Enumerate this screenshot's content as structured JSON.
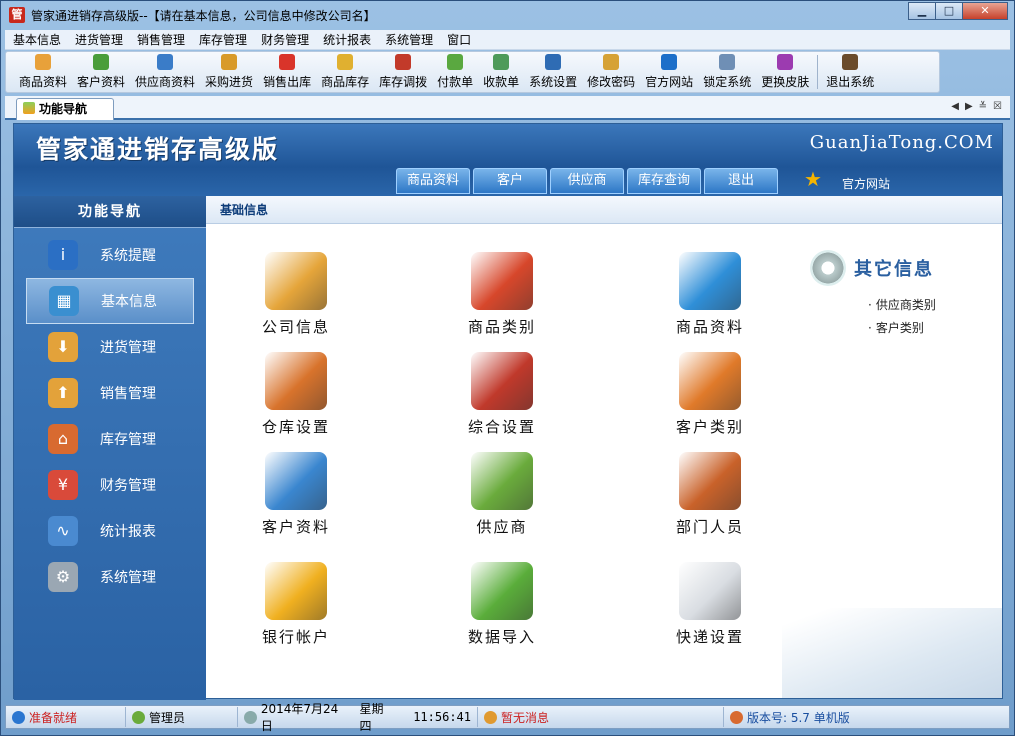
{
  "window": {
    "title": "管家通进销存高级版--【请在基本信息，公司信息中修改公司名】",
    "app_icon": "管",
    "min": "▁",
    "max": "□",
    "close": "✕"
  },
  "menu": [
    "基本信息",
    "进货管理",
    "销售管理",
    "库存管理",
    "财务管理",
    "统计报表",
    "系统管理",
    "窗口"
  ],
  "toolbar": [
    {
      "label": "商品资料",
      "icon": "goods-icon",
      "color": "#e8a13a"
    },
    {
      "label": "客户资料",
      "icon": "customer-icon",
      "color": "#4a9d3a"
    },
    {
      "label": "供应商资料",
      "icon": "supplier-icon",
      "color": "#3a7cc8"
    },
    {
      "label": "采购进货",
      "icon": "truck-icon",
      "color": "#d89a2a"
    },
    {
      "label": "销售出库",
      "icon": "cart-icon",
      "color": "#d9342a"
    },
    {
      "label": "商品库存",
      "icon": "box-icon",
      "color": "#e0b030"
    },
    {
      "label": "库存调拨",
      "icon": "transfer-icon",
      "color": "#c23a2a"
    },
    {
      "label": "付款单",
      "icon": "pay-icon",
      "color": "#5aa840"
    },
    {
      "label": "收款单",
      "icon": "receive-icon",
      "color": "#4e9a5a"
    },
    {
      "label": "系统设置",
      "icon": "settings-icon",
      "color": "#2f6cb4"
    },
    {
      "label": "修改密码",
      "icon": "key-icon",
      "color": "#d6a236"
    },
    {
      "label": "官方网站",
      "icon": "ie-icon",
      "color": "#1d6fc9"
    },
    {
      "label": "锁定系统",
      "icon": "lock-icon",
      "color": "#6f8fb5"
    },
    {
      "label": "更换皮肤",
      "icon": "skin-icon",
      "color": "#9c3bb0"
    },
    {
      "label": "退出系统",
      "icon": "exit-icon",
      "color": "#6b4b2b"
    }
  ],
  "tab": {
    "label": "功能导航"
  },
  "header": {
    "brand": "管家通进销存高级版",
    "site": "GuanJiaTong.COM",
    "tabs": [
      "商品资料",
      "客户",
      "供应商",
      "库存查询",
      "退出"
    ],
    "home": "官方网站"
  },
  "sidebar": {
    "title": "功能导航",
    "items": [
      {
        "label": "系统提醒",
        "icon": "info-icon",
        "color": "#2b6fc4",
        "glyph": "i"
      },
      {
        "label": "基本信息",
        "icon": "cubes-icon",
        "color": "#3a8fd0",
        "glyph": "▦"
      },
      {
        "label": "进货管理",
        "icon": "box-in-icon",
        "color": "#e3a23a",
        "glyph": "⬇"
      },
      {
        "label": "销售管理",
        "icon": "box-out-icon",
        "color": "#e3a23a",
        "glyph": "⬆"
      },
      {
        "label": "库存管理",
        "icon": "house-icon",
        "color": "#d86a30",
        "glyph": "⌂"
      },
      {
        "label": "财务管理",
        "icon": "money-icon",
        "color": "#d94a3a",
        "glyph": "¥"
      },
      {
        "label": "统计报表",
        "icon": "chart-icon",
        "color": "#4a8ad0",
        "glyph": "∿"
      },
      {
        "label": "系统管理",
        "icon": "gears-icon",
        "color": "#9aa7b3",
        "glyph": "⚙"
      }
    ]
  },
  "content": {
    "section": "基础信息",
    "items": [
      {
        "label": "公司信息",
        "icon": "shop-icon",
        "color": "#e5a53a"
      },
      {
        "label": "商品类别",
        "icon": "shapes-icon",
        "color": "#d7472b"
      },
      {
        "label": "商品资料",
        "icon": "cubes-icon",
        "color": "#2f8fd8"
      },
      {
        "label": "仓库设置",
        "icon": "warehouse-icon",
        "color": "#d8732c"
      },
      {
        "label": "综合设置",
        "icon": "tools-icon",
        "color": "#c0392b"
      },
      {
        "label": "客户类别",
        "icon": "shapes-icon",
        "color": "#e07a2a"
      },
      {
        "label": "客户资料",
        "icon": "users-icon",
        "color": "#3a86cf"
      },
      {
        "label": "供应商",
        "icon": "user-icon",
        "color": "#6aab3c"
      },
      {
        "label": "部门人员",
        "icon": "people-icon",
        "color": "#c9622a"
      },
      {
        "label": "银行帐户",
        "icon": "money-bag-icon",
        "color": "#f0b020"
      },
      {
        "label": "数据导入",
        "icon": "import-icon",
        "color": "#5aad3a"
      },
      {
        "label": "快递设置",
        "icon": "envelope-icon",
        "color": "#d9dde2"
      }
    ],
    "other": {
      "title": "其它信息",
      "links": [
        "供应商类别",
        "客户类别"
      ]
    }
  },
  "status": {
    "ready": "准备就绪",
    "user": "管理员",
    "date": "2014年7月24日",
    "weekday": "星期四",
    "time": "11:56:41",
    "msg": "暂无消息",
    "version": "版本号: 5.7 单机版"
  }
}
